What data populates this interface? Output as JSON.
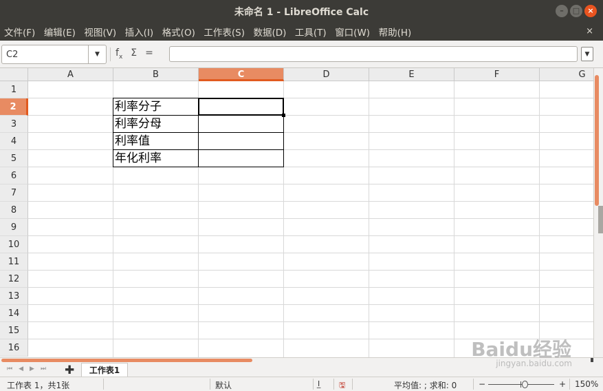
{
  "window": {
    "title": "未命名 1 - LibreOffice Calc"
  },
  "menu": {
    "items": [
      "文件(F)",
      "编辑(E)",
      "视图(V)",
      "插入(I)",
      "格式(O)",
      "工作表(S)",
      "数据(D)",
      "工具(T)",
      "窗口(W)",
      "帮助(H)"
    ],
    "close_doc": "×"
  },
  "formula_bar": {
    "name_box": "C2",
    "fx_icon": "f(x)-icon",
    "sum_icon": "Σ",
    "equals": "=",
    "formula_value": ""
  },
  "grid": {
    "columns": [
      "A",
      "B",
      "C",
      "D",
      "E",
      "F",
      "G"
    ],
    "active_column": "C",
    "rows": [
      "1",
      "2",
      "3",
      "4",
      "5",
      "6",
      "7",
      "8",
      "9",
      "10",
      "11",
      "12",
      "13",
      "14",
      "15",
      "16"
    ],
    "active_row": "2",
    "cells": {
      "B2": "利率分子",
      "B3": "利率分母",
      "B4": "利率值",
      "B5": "年化利率"
    }
  },
  "sheet_tabs": {
    "tabs": [
      "工作表1"
    ],
    "add_icon": "plus-icon"
  },
  "status_bar": {
    "sheet_info": "工作表 1，共1张",
    "page_style": "默认",
    "stats": "平均值: ; 求和: 0",
    "zoom_minus": "−",
    "zoom_plus": "+",
    "zoom_level": "150%"
  },
  "colors": {
    "accent": "#e88b62",
    "titlebar": "#3c3b37",
    "close_button": "#e95420"
  },
  "watermark": {
    "text": "Baidu经验",
    "sub": "jingyan.baidu.com"
  }
}
